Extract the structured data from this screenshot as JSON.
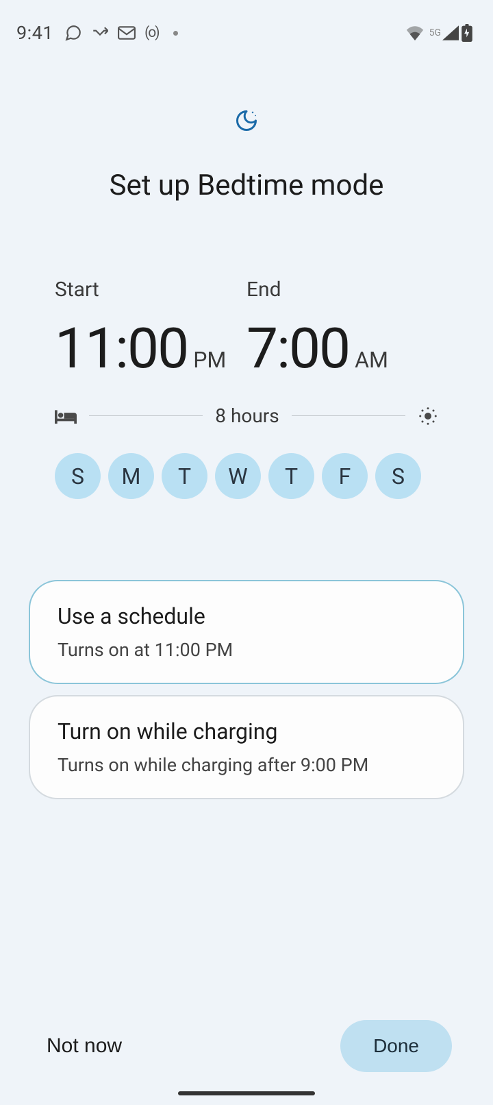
{
  "status": {
    "time": "9:41",
    "o_badge": "(o)",
    "network": "5G"
  },
  "header": {
    "title": "Set up Bedtime mode"
  },
  "schedule": {
    "start_label": "Start",
    "start_time": "11:00",
    "start_period": "PM",
    "end_label": "End",
    "end_time": "7:00",
    "end_period": "AM",
    "duration": "8 hours",
    "days": [
      "S",
      "M",
      "T",
      "W",
      "T",
      "F",
      "S"
    ]
  },
  "options": [
    {
      "title": "Use a schedule",
      "subtitle": "Turns on at 11:00 PM",
      "selected": true
    },
    {
      "title": "Turn on while charging",
      "subtitle": "Turns on while charging after 9:00 PM",
      "selected": false
    }
  ],
  "actions": {
    "not_now": "Not now",
    "done": "Done"
  }
}
